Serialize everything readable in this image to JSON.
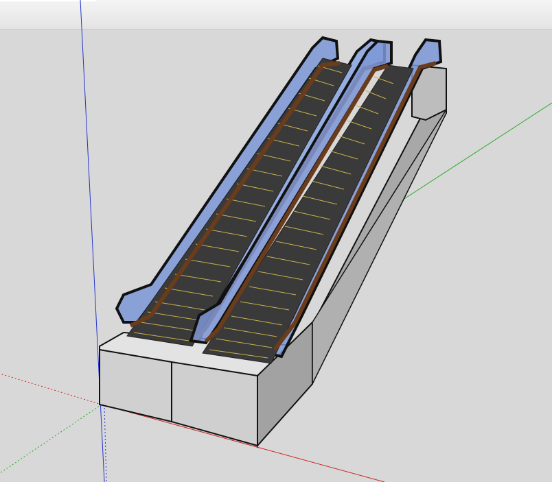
{
  "viewport": {
    "background": "#d8d8d8",
    "sky_band_color": "#ececec"
  },
  "axes": {
    "red": "#cc2222",
    "green": "#22aa22",
    "blue": "#2233cc"
  },
  "model": {
    "escalator_count": 2,
    "steps_per_escalator": 26,
    "colors": {
      "glass": "#7d98d8",
      "glass_light": "#a9bdf0",
      "handrail_wood": "#6b3c1c",
      "outline": "#111111",
      "step": "#333333",
      "step_edge": "#c9b24a",
      "base_top": "#e0e0e0",
      "base_front": "#cfcfcf",
      "base_side": "#9e9e9e",
      "truss": "#a6a6a6"
    }
  }
}
